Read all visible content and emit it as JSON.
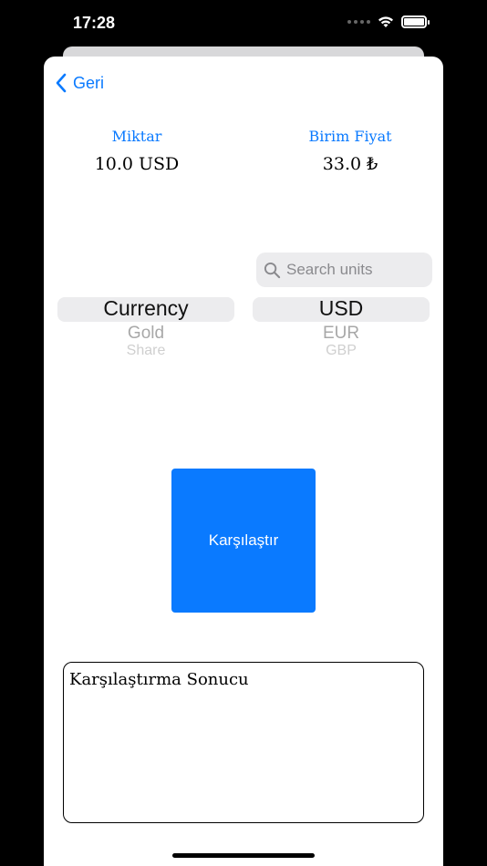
{
  "status_bar": {
    "time": "17:28"
  },
  "nav": {
    "back_label": "Geri"
  },
  "quantity": {
    "label": "Miktar",
    "value": "10.0 USD"
  },
  "unit_price": {
    "label": "Birim Fiyat",
    "value": "33.0 ₺"
  },
  "search": {
    "placeholder": "Search units"
  },
  "category_picker": {
    "items": [
      "Currency",
      "Gold",
      "Share"
    ]
  },
  "unit_picker": {
    "items": [
      "USD",
      "EUR",
      "GBP"
    ]
  },
  "compare_button": {
    "label": "Karşılaştır"
  },
  "result": {
    "text": "Karşılaştırma Sonucu"
  },
  "colors": {
    "accent": "#0a7aff"
  }
}
